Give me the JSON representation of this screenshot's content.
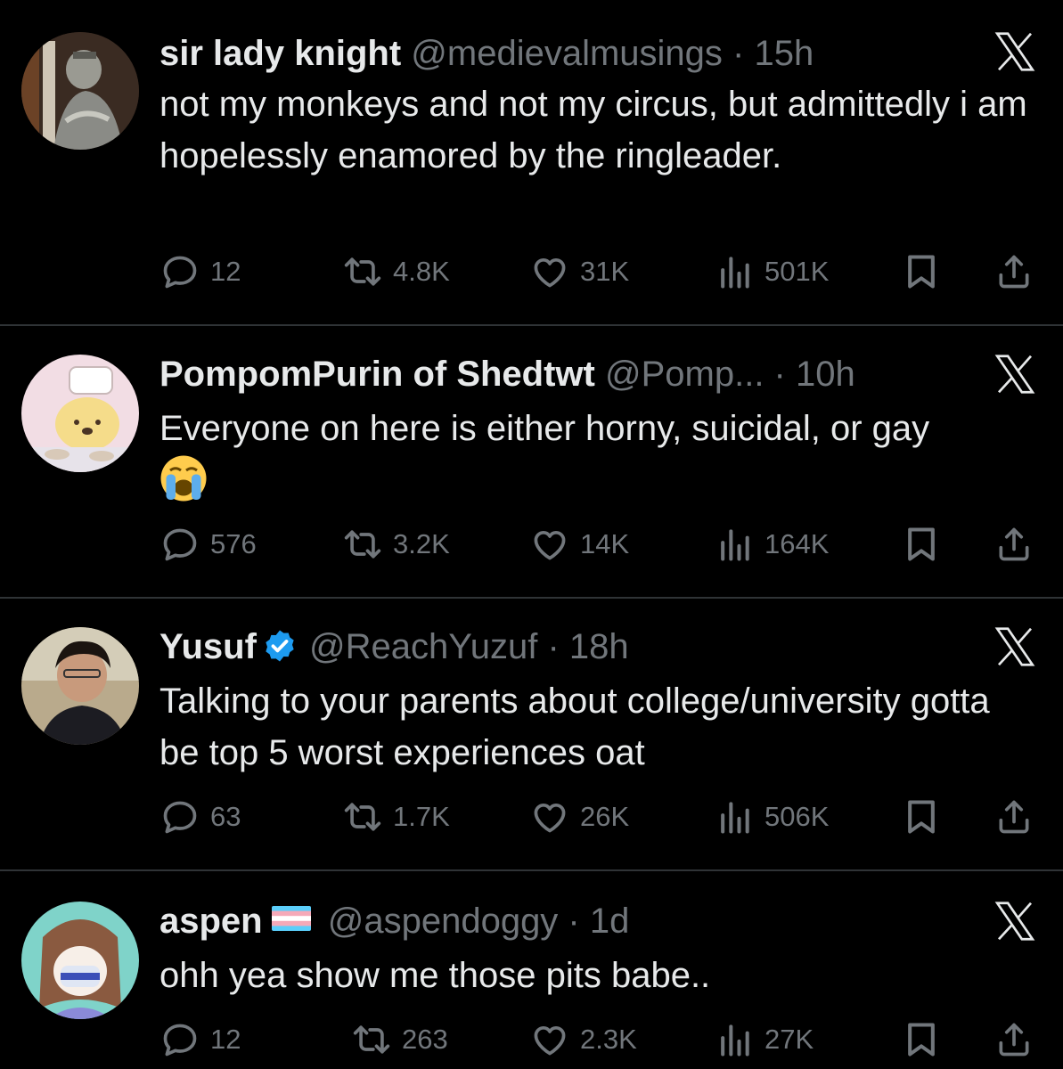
{
  "tweets": [
    {
      "name": "sir lady knight",
      "handle": "@medievalmusings",
      "dot": " · ",
      "time": "15h",
      "text": "not my monkeys and not my circus, but admittedly i am hopelessly enamored by the ringleader.",
      "replies": "12",
      "reposts": "4.8K",
      "likes": "31K",
      "views": "501K"
    },
    {
      "name": "PompomPurin of Shedtwt",
      "handle": "@Pomp...",
      "dot": " · ",
      "time": "10h",
      "text": "Everyone on here is either horny, suicidal, or gay",
      "emoji": "loudly-crying-face",
      "replies": "576",
      "reposts": "3.2K",
      "likes": "14K",
      "views": "164K"
    },
    {
      "name": "Yusuf",
      "verified": true,
      "handle": "@ReachYuzuf",
      "dot": " · ",
      "time": "18h",
      "text": "Talking to your parents about college/university gotta be top 5 worst experiences oat",
      "replies": "63",
      "reposts": "1.7K",
      "likes": "26K",
      "views": "506K"
    },
    {
      "name": "aspen",
      "flag": "transgender-flag",
      "handle": "@aspendoggy",
      "dot": " · ",
      "time": "1d",
      "text": "ohh yea show me those pits babe..",
      "replies": "12",
      "reposts": "263",
      "likes": "2.3K",
      "views": "27K"
    }
  ],
  "colors": {
    "background": "#000000",
    "text": "#e7e9ea",
    "muted": "#71767b",
    "divider": "#2f3336",
    "verified": "#1d9bf0"
  },
  "icons": [
    "x-logo-icon",
    "reply-icon",
    "repost-icon",
    "like-icon",
    "views-icon",
    "bookmark-icon",
    "share-icon",
    "verified-badge-icon"
  ]
}
